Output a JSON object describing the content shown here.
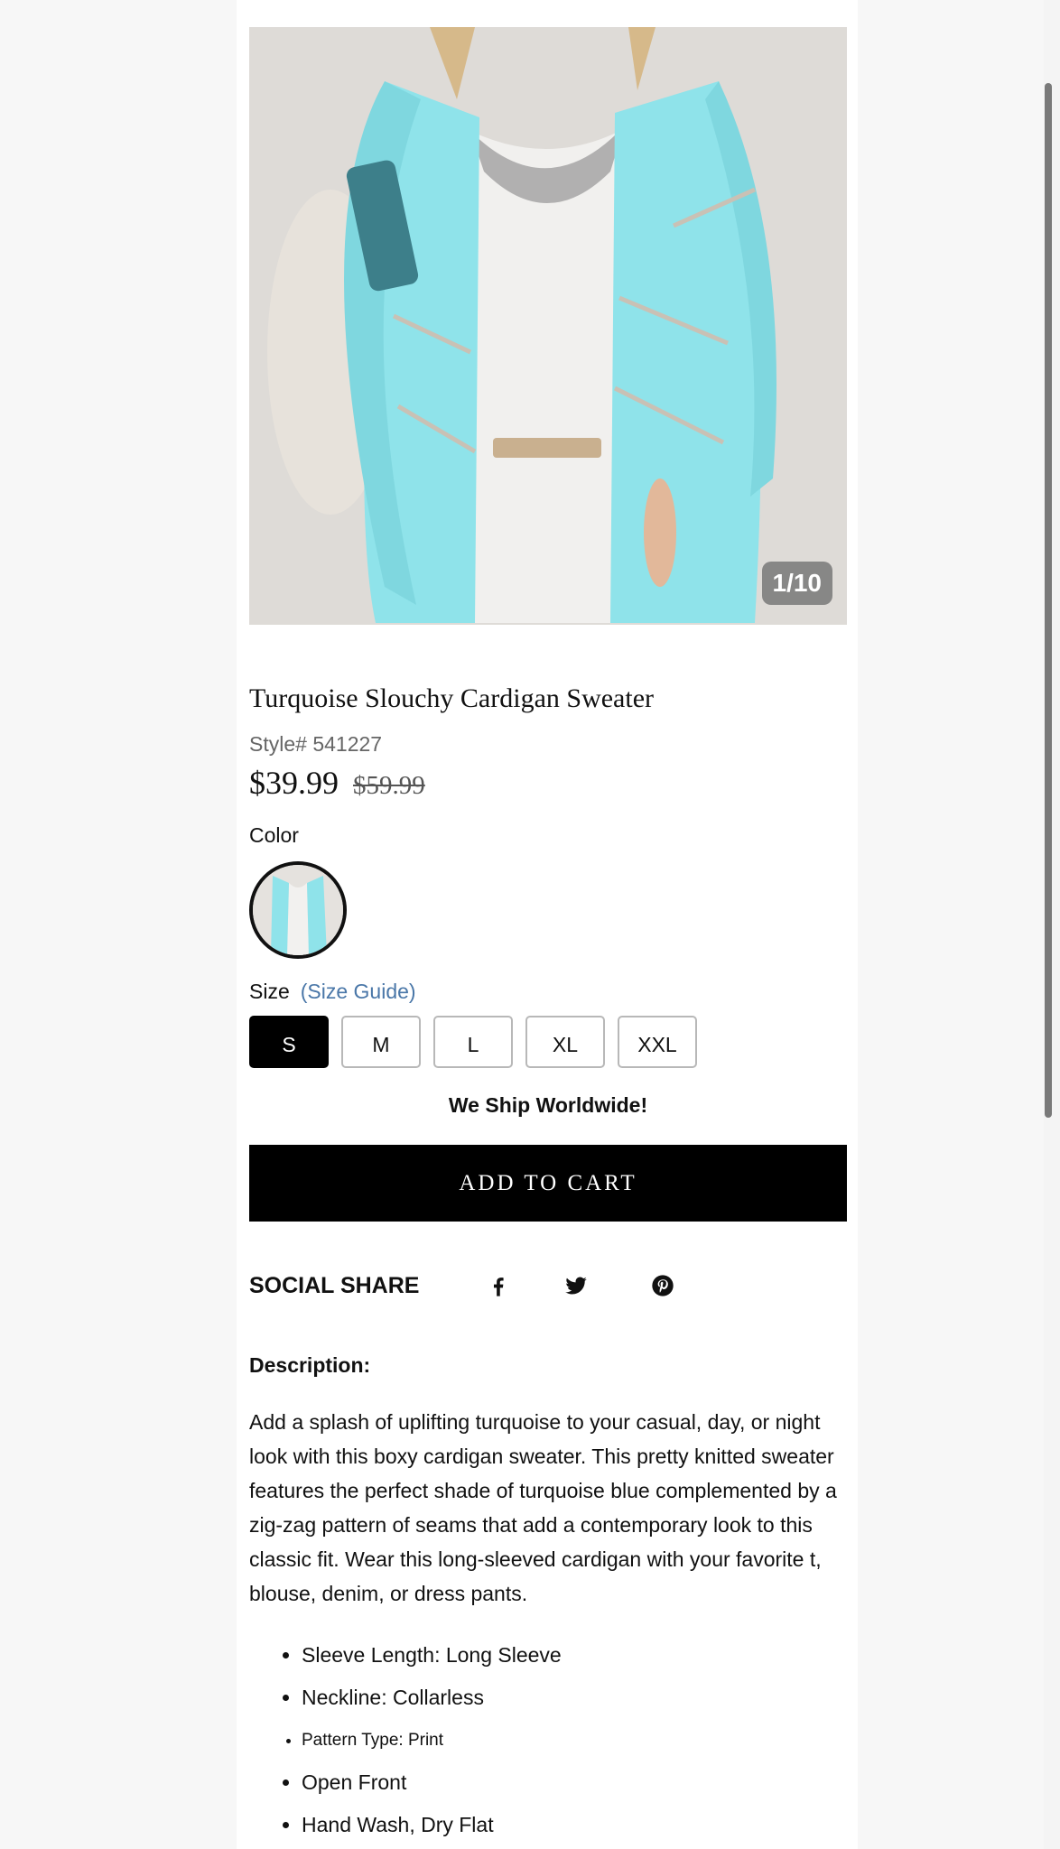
{
  "product": {
    "image_counter": "1/10",
    "title": "Turquoise Slouchy Cardigan Sweater",
    "style_number": "Style# 541227",
    "price_current": "$39.99",
    "price_original": "$59.99",
    "color_label": "Color",
    "size_label": "Size",
    "size_guide_label": "(Size Guide)",
    "sizes": [
      "S",
      "M",
      "L",
      "XL",
      "XXL"
    ],
    "selected_size": "S",
    "shipping_note": "We Ship Worldwide!",
    "add_to_cart_label": "ADD TO CART"
  },
  "social": {
    "label": "SOCIAL SHARE",
    "icons": [
      "facebook-icon",
      "twitter-icon",
      "pinterest-icon"
    ]
  },
  "description": {
    "heading": "Description:",
    "body": "Add a splash of uplifting turquoise to your casual, day, or night look with this boxy cardigan sweater. This pretty knitted sweater features the perfect shade of turquoise blue complemented by a zig-zag pattern of seams that add a contemporary look to this classic fit. Wear this long-sleeved cardigan with your favorite t, blouse, denim, or dress pants.",
    "features": [
      "Sleeve Length: Long Sleeve",
      "Neckline: Collarless",
      "Pattern Type: Print",
      "Open Front",
      "Hand Wash, Dry Flat"
    ]
  },
  "colors": {
    "accent_link": "#4a77a8",
    "button_black": "#000000",
    "cardigan_turquoise": "#8fe3ea"
  }
}
